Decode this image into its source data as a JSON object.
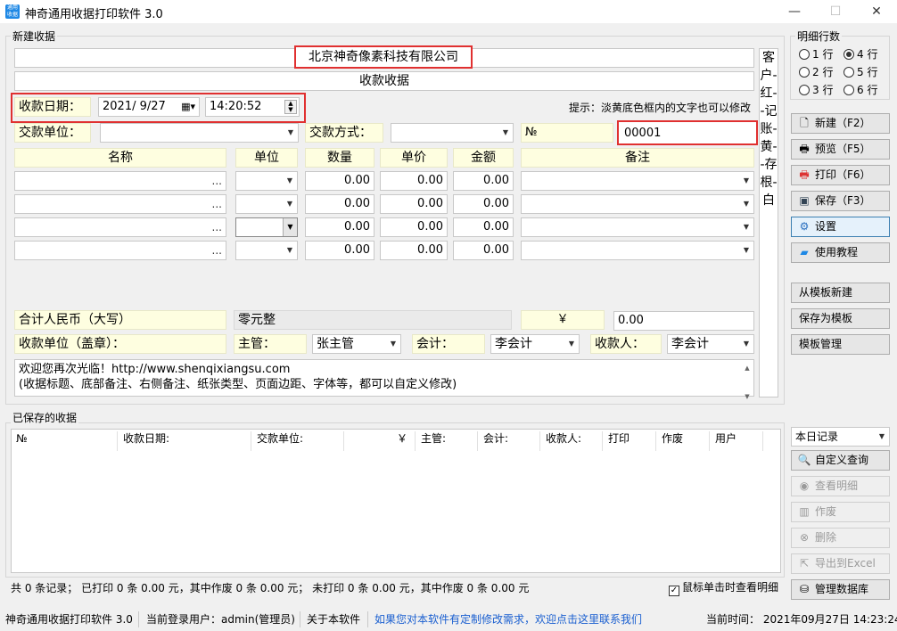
{
  "window": {
    "title": "神奇通用收据打印软件 3.0",
    "minimize": "—",
    "maximize": "☐",
    "close": "✕"
  },
  "new_receipt": {
    "group_label": "新建收据",
    "company": "北京神奇像素科技有限公司",
    "receipt_title": "收款收据",
    "date_label": "收款日期：",
    "date_value": "2021/  9/27",
    "time_value": "14:20:52",
    "hint": "提示：淡黄底色框内的文字也可以修改",
    "payer_label": "交款单位：",
    "method_label": "交款方式：",
    "no_label": "№",
    "no_value": "00001",
    "side_text": "客户-红--记账-黄--存根-白",
    "columns": [
      "名称",
      "单位",
      "数量",
      "单价",
      "金额",
      "备注"
    ],
    "rows": [
      {
        "qty": "0.00",
        "price": "0.00",
        "amount": "0.00"
      },
      {
        "qty": "0.00",
        "price": "0.00",
        "amount": "0.00"
      },
      {
        "qty": "0.00",
        "price": "0.00",
        "amount": "0.00"
      },
      {
        "qty": "0.00",
        "price": "0.00",
        "amount": "0.00"
      }
    ],
    "total_label": "合计人民币（大写）",
    "total_words": "零元整",
    "yen": "￥",
    "total_amount": "0.00",
    "stamp_label": "收款单位（盖章）：",
    "supervisor_label": "主管：",
    "supervisor_value": "张主管",
    "accountant_label": "会计：",
    "accountant_value": "李会计",
    "payee_label": "收款人：",
    "payee_value": "李会计",
    "footer_line1": "欢迎您再次光临！http://www.shenqixiangsu.com",
    "footer_line2": "(收据标题、底部备注、右侧备注、纸张类型、页面边距、字体等，都可以自定义修改)"
  },
  "detail_rows": {
    "label": "明细行数",
    "options": [
      "1 行",
      "4 行",
      "2 行",
      "5 行",
      "3 行",
      "6 行"
    ],
    "selected": "4 行"
  },
  "actions": {
    "new": "新建（F2）",
    "preview": "预览（F5）",
    "print": "打印（F6）",
    "save": "保存（F3）",
    "settings": "设置",
    "tutorial": "使用教程",
    "from_template": "从模板新建",
    "save_as_template": "保存为模板",
    "template_manage": "模板管理"
  },
  "saved": {
    "group_label": "已保存的收据",
    "columns": [
      "№",
      "收款日期:",
      "交款单位:",
      "￥",
      "主管:",
      "会计:",
      "收款人:",
      "打印",
      "作废",
      "用户"
    ],
    "filter": "本日记录",
    "custom_query": "自定义查询",
    "view_detail": "查看明细",
    "void": "作废",
    "delete": "删除",
    "export": "导出到Excel",
    "manage_db": "管理数据库",
    "summary": "共 0 条记录；   已打印 0 条 0.00 元，其中作废 0 条 0.00 元；   未打印 0 条 0.00 元，其中作废 0 条 0.00 元",
    "click_detail": "鼠标单击时查看明细"
  },
  "status": {
    "app": "神奇通用收据打印软件 3.0",
    "user": "当前登录用户：admin(管理员)",
    "about": "关于本软件",
    "contact": "如果您对本软件有定制修改需求，欢迎点击这里联系我们",
    "time": "当前时间：  2021年09月27日  14:23:24"
  }
}
